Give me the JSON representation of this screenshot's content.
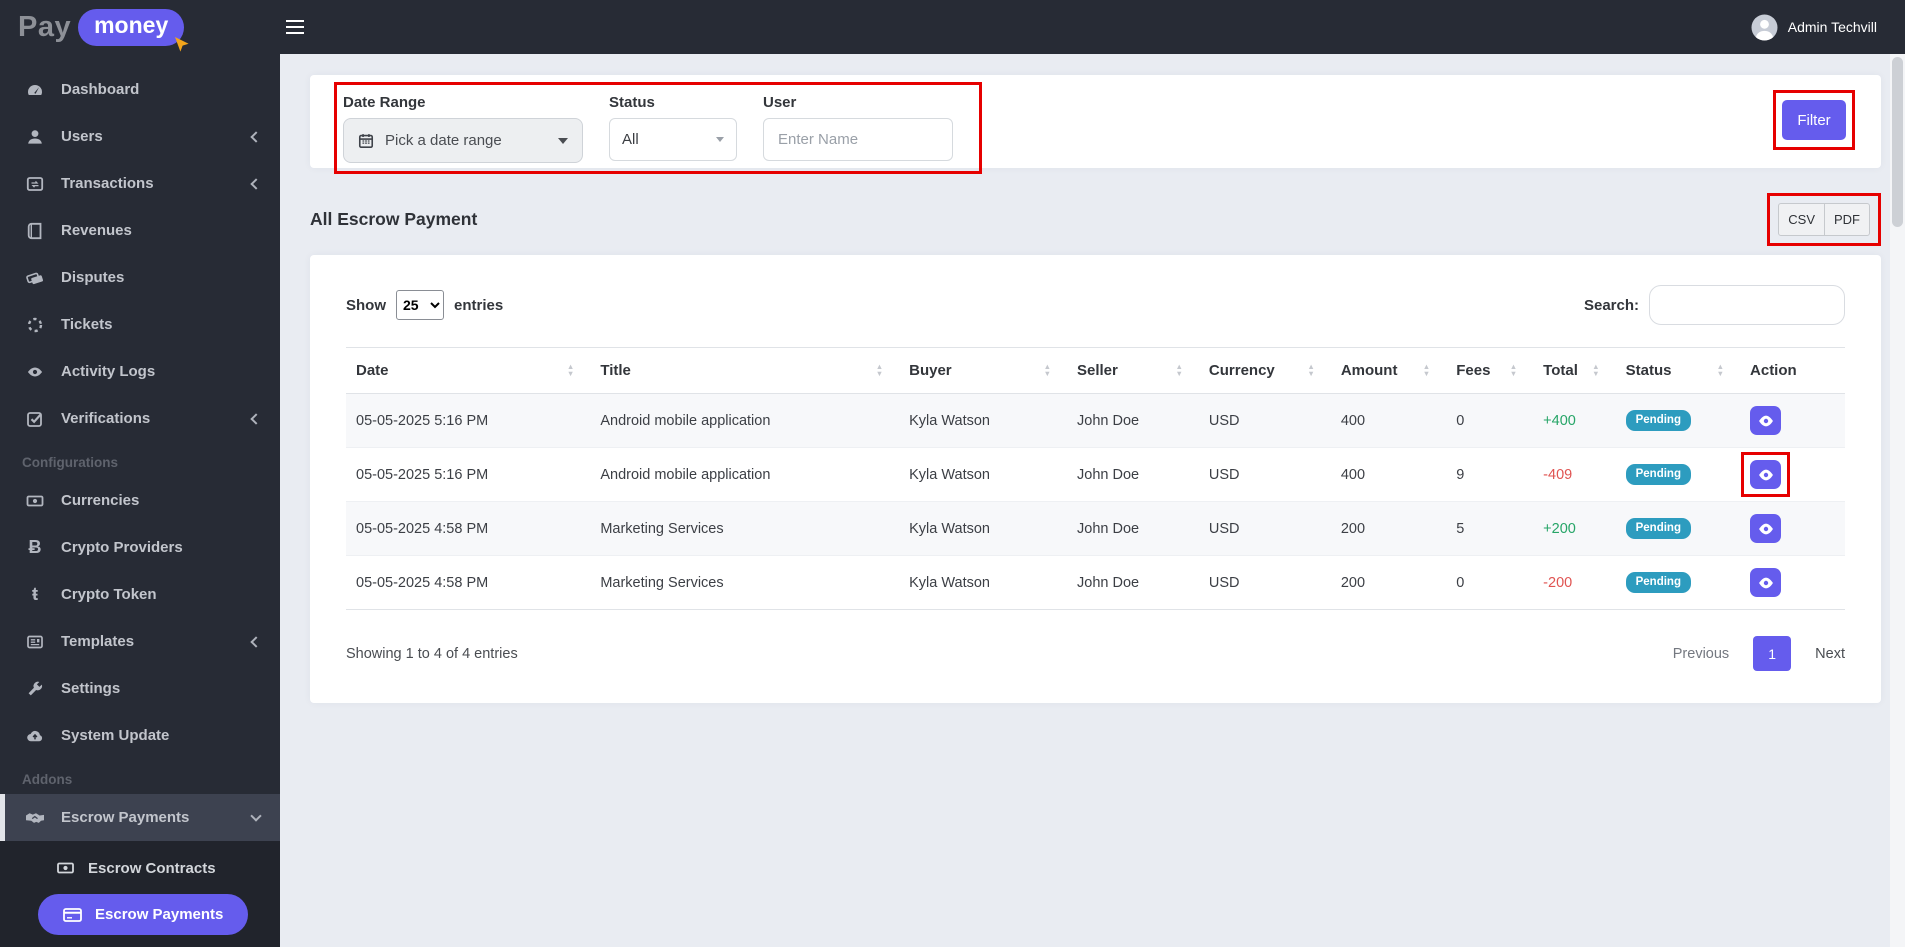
{
  "colors": {
    "accent": "#655ced",
    "annotation": "#e60000",
    "badge_info": "#2d9cbf",
    "positive": "#26a567",
    "negative": "#e05452",
    "sidebar_bg": "#272b35"
  },
  "brand": {
    "pay": "Pay",
    "money": "money"
  },
  "topbar": {
    "admin_name": "Admin Techvill"
  },
  "sidebar": {
    "items": [
      {
        "label": "Dashboard",
        "icon": "gauge-icon"
      },
      {
        "label": "Users",
        "icon": "user-icon",
        "chevron": "left"
      },
      {
        "label": "Transactions",
        "icon": "exchange-window-icon",
        "chevron": "left"
      },
      {
        "label": "Revenues",
        "icon": "book-icon"
      },
      {
        "label": "Disputes",
        "icon": "tags-icon"
      },
      {
        "label": "Tickets",
        "icon": "spinner-icon"
      },
      {
        "label": "Activity Logs",
        "icon": "eye-icon"
      },
      {
        "label": "Verifications",
        "icon": "check-square-icon",
        "chevron": "left"
      }
    ],
    "config_header": "Configurations",
    "config_items": [
      {
        "label": "Currencies",
        "icon": "money-bill-icon"
      },
      {
        "label": "Crypto Providers",
        "icon": "bitcoin-icon"
      },
      {
        "label": "Crypto Token",
        "icon": "crypto-token-icon"
      },
      {
        "label": "Templates",
        "icon": "newspaper-icon",
        "chevron": "left"
      },
      {
        "label": "Settings",
        "icon": "wrench-icon"
      },
      {
        "label": "System Update",
        "icon": "cloud-upload-icon"
      }
    ],
    "addons_header": "Addons",
    "addons_item": {
      "label": "Escrow Payments",
      "icon": "handshake-icon",
      "chevron": "down",
      "active": true
    },
    "submenu": [
      {
        "label": "Escrow Contracts",
        "icon": "money-bill-icon"
      },
      {
        "label": "Escrow Payments",
        "icon": "credit-card-icon",
        "active": true
      }
    ]
  },
  "filter": {
    "date_range_label": "Date Range",
    "date_range_value": "Pick a date range",
    "status_label": "Status",
    "status_value": "All",
    "user_label": "User",
    "user_placeholder": "Enter Name",
    "button_label": "Filter"
  },
  "page": {
    "title": "All Escrow Payment",
    "export_csv": "CSV",
    "export_pdf": "PDF"
  },
  "table_controls": {
    "show_label": "Show",
    "page_size": "25",
    "entries_label": "entries",
    "search_label": "Search:"
  },
  "table": {
    "columns": [
      {
        "key": "date",
        "label": "Date",
        "sortable": true
      },
      {
        "key": "title",
        "label": "Title",
        "sortable": true
      },
      {
        "key": "buyer",
        "label": "Buyer",
        "sortable": true
      },
      {
        "key": "seller",
        "label": "Seller",
        "sortable": true
      },
      {
        "key": "currency",
        "label": "Currency",
        "sortable": true
      },
      {
        "key": "amount",
        "label": "Amount",
        "sortable": true
      },
      {
        "key": "fees",
        "label": "Fees",
        "sortable": true
      },
      {
        "key": "total",
        "label": "Total",
        "sortable": true
      },
      {
        "key": "status",
        "label": "Status",
        "sortable": true
      },
      {
        "key": "action",
        "label": "Action",
        "sortable": false
      }
    ],
    "rows": [
      {
        "date": "05-05-2025 5:16 PM",
        "title": "Android mobile application",
        "buyer": "Kyla Watson",
        "seller": "John Doe",
        "currency": "USD",
        "amount": "400",
        "fees": "0",
        "total": "+400",
        "status": "Pending",
        "annotated": false
      },
      {
        "date": "05-05-2025 5:16 PM",
        "title": "Android mobile application",
        "buyer": "Kyla Watson",
        "seller": "John Doe",
        "currency": "USD",
        "amount": "400",
        "fees": "9",
        "total": "-409",
        "status": "Pending",
        "annotated": true
      },
      {
        "date": "05-05-2025 4:58 PM",
        "title": "Marketing Services",
        "buyer": "Kyla Watson",
        "seller": "John Doe",
        "currency": "USD",
        "amount": "200",
        "fees": "5",
        "total": "+200",
        "status": "Pending",
        "annotated": false
      },
      {
        "date": "05-05-2025 4:58 PM",
        "title": "Marketing Services",
        "buyer": "Kyla Watson",
        "seller": "John Doe",
        "currency": "USD",
        "amount": "200",
        "fees": "0",
        "total": "-200",
        "status": "Pending",
        "annotated": false
      }
    ]
  },
  "footer": {
    "summary": "Showing 1 to 4 of 4 entries",
    "previous_label": "Previous",
    "current_page": "1",
    "next_label": "Next"
  }
}
